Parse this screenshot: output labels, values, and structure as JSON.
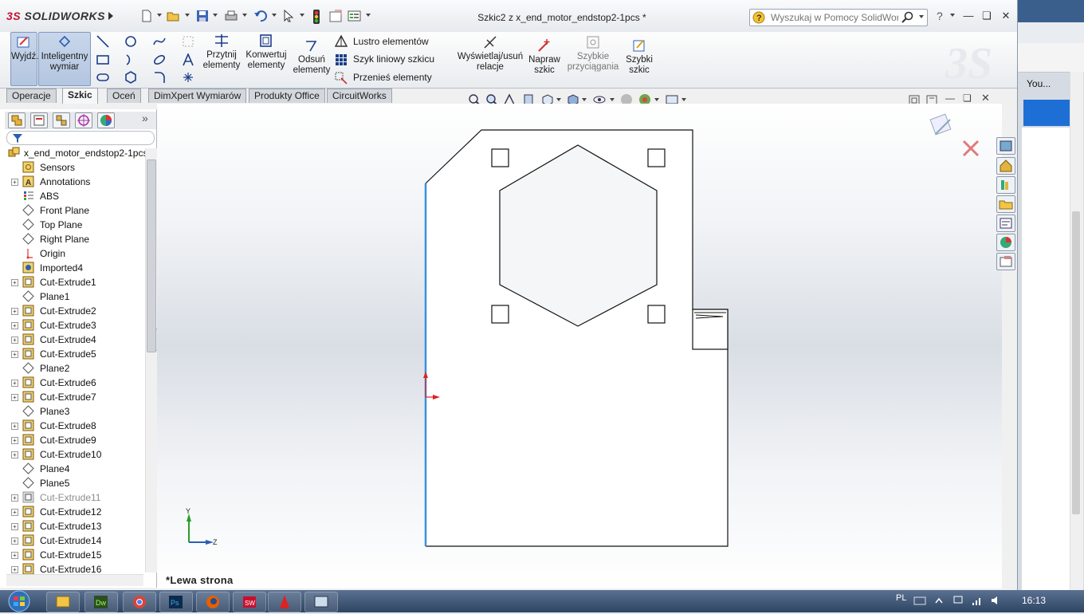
{
  "background_window": {
    "tab_text": "You..."
  },
  "app": {
    "logo": "SOLIDWORKS",
    "logo_prefix": "3S",
    "document_title": "Szkic2 z x_end_motor_endstop2-1pcs *"
  },
  "search": {
    "placeholder": "Wyszukaj w Pomocy SolidWorks"
  },
  "command_manager": {
    "exit_sketch": "Wyjdź...",
    "smart_dimension": "Inteligentny wymiar",
    "trim": "Przytnij elementy",
    "convert": "Konwertuj elementy",
    "offset": "Odsuń elementy",
    "mirror": "Lustro elementów",
    "linear_pattern": "Szyk liniowy szkicu",
    "move": "Przenieś elementy",
    "relations": "Wyświetlaj/usuń relacje",
    "repair": "Napraw szkic",
    "quick_snaps": "Szybkie przyciągania",
    "rapid_sketch": "Szybki szkic"
  },
  "tabs": [
    "Operacje",
    "Szkic",
    "Oceń",
    "DimXpert Wymiarów",
    "Produkty Office",
    "CircuitWorks"
  ],
  "active_tab": "Szkic",
  "tree": {
    "root": "x_end_motor_endstop2-1pcs",
    "items": [
      {
        "label": "Sensors",
        "icon": "sensors-icon",
        "expand": false
      },
      {
        "label": "Annotations",
        "icon": "annotations-icon",
        "expand": true
      },
      {
        "label": "ABS",
        "icon": "material-icon",
        "expand": false
      },
      {
        "label": "Front Plane",
        "icon": "plane-icon",
        "expand": false
      },
      {
        "label": "Top Plane",
        "icon": "plane-icon",
        "expand": false
      },
      {
        "label": "Right Plane",
        "icon": "plane-icon",
        "expand": false
      },
      {
        "label": "Origin",
        "icon": "origin-icon",
        "expand": false
      },
      {
        "label": "Imported4",
        "icon": "imported-body-icon",
        "expand": false
      },
      {
        "label": "Cut-Extrude1",
        "icon": "cut-extrude-icon",
        "expand": true
      },
      {
        "label": "Plane1",
        "icon": "plane-icon",
        "expand": false
      },
      {
        "label": "Cut-Extrude2",
        "icon": "cut-extrude-icon",
        "expand": true
      },
      {
        "label": "Cut-Extrude3",
        "icon": "cut-extrude-icon",
        "expand": true
      },
      {
        "label": "Cut-Extrude4",
        "icon": "cut-extrude-icon",
        "expand": true
      },
      {
        "label": "Cut-Extrude5",
        "icon": "cut-extrude-icon",
        "expand": true
      },
      {
        "label": "Plane2",
        "icon": "plane-icon",
        "expand": false
      },
      {
        "label": "Cut-Extrude6",
        "icon": "cut-extrude-icon",
        "expand": true
      },
      {
        "label": "Cut-Extrude7",
        "icon": "cut-extrude-icon",
        "expand": true
      },
      {
        "label": "Plane3",
        "icon": "plane-icon",
        "expand": false
      },
      {
        "label": "Cut-Extrude8",
        "icon": "cut-extrude-icon",
        "expand": true
      },
      {
        "label": "Cut-Extrude9",
        "icon": "cut-extrude-icon",
        "expand": true
      },
      {
        "label": "Cut-Extrude10",
        "icon": "cut-extrude-icon",
        "expand": true
      },
      {
        "label": "Plane4",
        "icon": "plane-icon",
        "expand": false
      },
      {
        "label": "Plane5",
        "icon": "plane-icon",
        "expand": false
      },
      {
        "label": "Cut-Extrude11",
        "icon": "cut-extrude-icon",
        "expand": true,
        "suppressed": true
      },
      {
        "label": "Cut-Extrude12",
        "icon": "cut-extrude-icon",
        "expand": true
      },
      {
        "label": "Cut-Extrude13",
        "icon": "cut-extrude-icon",
        "expand": true
      },
      {
        "label": "Cut-Extrude14",
        "icon": "cut-extrude-icon",
        "expand": true
      },
      {
        "label": "Cut-Extrude15",
        "icon": "cut-extrude-icon",
        "expand": true
      },
      {
        "label": "Cut-Extrude16",
        "icon": "cut-extrude-icon",
        "expand": true
      }
    ]
  },
  "graphics": {
    "view_name": "*Lewa strona",
    "triad": {
      "y": "Y",
      "z": "Z"
    }
  },
  "taskbar": {
    "lang": "PL",
    "time": "16:13"
  },
  "colors": {
    "accent": "#1d6fd6",
    "selected_line": "#3a8fe0",
    "brand": "#c8102e"
  }
}
